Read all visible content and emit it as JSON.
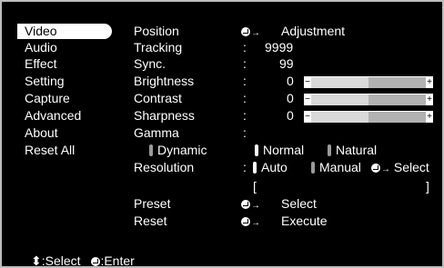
{
  "menu": [
    "Video",
    "Audio",
    "Effect",
    "Setting",
    "Capture",
    "Advanced",
    "About",
    "Reset All"
  ],
  "rows": {
    "position": {
      "label": "Position",
      "value": "Adjustment"
    },
    "tracking": {
      "label": "Tracking",
      "sep": ":",
      "value": "9999"
    },
    "sync": {
      "label": "Sync.",
      "sep": ":",
      "value": "99"
    },
    "brightness": {
      "label": "Brightness",
      "sep": ":",
      "value": "0"
    },
    "contrast": {
      "label": "Contrast",
      "sep": ":",
      "value": "0"
    },
    "sharpness": {
      "label": "Sharpness",
      "sep": ":",
      "value": "0"
    },
    "gamma": {
      "label": "Gamma",
      "sep": ":"
    },
    "gamma_options": [
      "Dynamic",
      "Normal",
      "Natural"
    ],
    "resolution": {
      "label": "Resolution",
      "sep": ":",
      "auto": "Auto",
      "manual": "Manual",
      "select": "Select"
    },
    "bracket_open": "[",
    "bracket_close": "]",
    "preset": {
      "label": "Preset",
      "value": "Select"
    },
    "reset": {
      "label": "Reset",
      "value": "Execute"
    }
  },
  "footer": {
    "select": ":Select",
    "enter": ":Enter",
    "updown": "⬍"
  },
  "arrow": "→",
  "sliders": {
    "brightness": 0.5,
    "contrast": 0.5,
    "sharpness": 0.5
  }
}
